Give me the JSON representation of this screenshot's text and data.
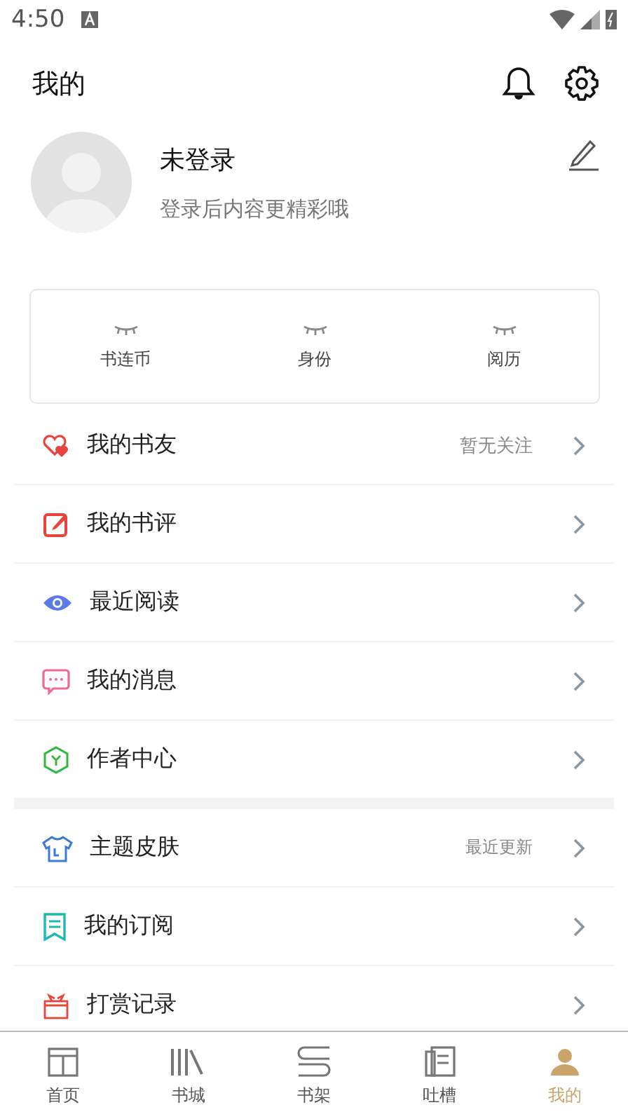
{
  "status_bar": {
    "time": "4:50"
  },
  "header": {
    "title": "我的"
  },
  "profile": {
    "name": "未登录",
    "subtitle": "登录后内容更精彩哦"
  },
  "stats": [
    {
      "label": "书连币"
    },
    {
      "label": "身份"
    },
    {
      "label": "阅历"
    }
  ],
  "menu_groups": [
    [
      {
        "label": "我的书友",
        "note": "暂无关注"
      },
      {
        "label": "我的书评"
      },
      {
        "label": "最近阅读"
      },
      {
        "label": "我的消息"
      },
      {
        "label": "作者中心"
      }
    ],
    [
      {
        "label": "主题皮肤",
        "note": "最近更新"
      },
      {
        "label": "我的订阅"
      },
      {
        "label": "打赏记录"
      }
    ]
  ],
  "tab_bar": [
    {
      "label": "首页",
      "selected": false
    },
    {
      "label": "书城",
      "selected": false
    },
    {
      "label": "书架",
      "selected": false
    },
    {
      "label": "吐槽",
      "selected": false
    },
    {
      "label": "我的",
      "selected": true
    }
  ]
}
